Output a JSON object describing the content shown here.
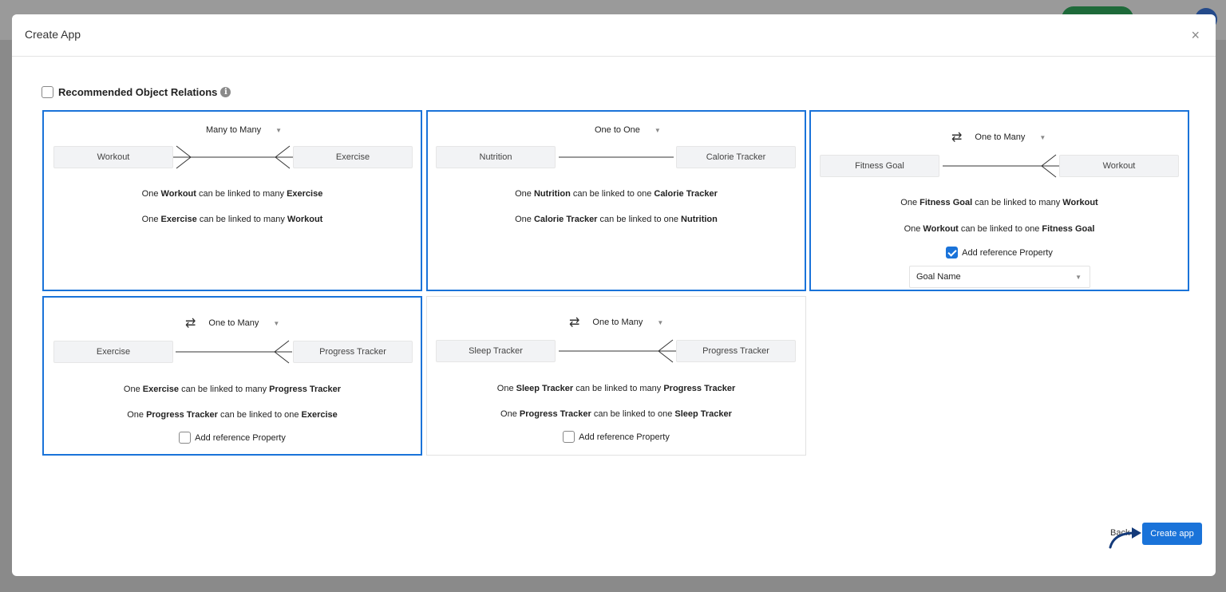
{
  "modal": {
    "title": "Create App",
    "close_icon": "×"
  },
  "section": {
    "title": "Recommended Object Relations",
    "info_icon": "i"
  },
  "cards": [
    {
      "relation": "Many to Many",
      "left": "Workout",
      "right": "Exercise",
      "line1": [
        "One ",
        "Workout",
        " can be linked to many ",
        "Exercise"
      ],
      "line2": [
        "One ",
        "Exercise",
        " can be linked to many ",
        "Workout"
      ]
    },
    {
      "relation": "One to One",
      "left": "Nutrition",
      "right": "Calorie Tracker",
      "line1": [
        "One ",
        "Nutrition",
        " can be linked to one ",
        "Calorie Tracker"
      ],
      "line2": [
        "One ",
        "Calorie Tracker",
        " can be linked to one ",
        "Nutrition"
      ]
    },
    {
      "relation": "One to Many",
      "left": "Fitness Goal",
      "right": "Workout",
      "line1": [
        "One ",
        "Fitness Goal",
        " can be linked to many ",
        "Workout"
      ],
      "line2": [
        "One ",
        "Workout",
        " can be linked to one ",
        "Fitness Goal"
      ],
      "ref_label": "Add reference Property",
      "ref_value": "Goal Name"
    },
    {
      "relation": "One to Many",
      "left": "Exercise",
      "right": "Progress Tracker",
      "line1": [
        "One ",
        "Exercise",
        " can be linked to many ",
        "Progress Tracker"
      ],
      "line2": [
        "One ",
        "Progress Tracker",
        " can be linked to one ",
        "Exercise"
      ],
      "ref_label": "Add reference Property"
    },
    {
      "relation": "One to Many",
      "left": "Sleep Tracker",
      "right": "Progress Tracker",
      "line1": [
        "One ",
        "Sleep Tracker",
        " can be linked to many ",
        "Progress Tracker"
      ],
      "line2": [
        "One ",
        "Progress Tracker",
        " can be linked to one ",
        "Sleep Tracker"
      ],
      "ref_label": "Add reference Property"
    }
  ],
  "footer": {
    "back_label": "Back",
    "create_label": "Create app"
  },
  "icons": {
    "swap": "⇄",
    "caret": "▼"
  },
  "colors": {
    "accent": "#1a73d9"
  }
}
